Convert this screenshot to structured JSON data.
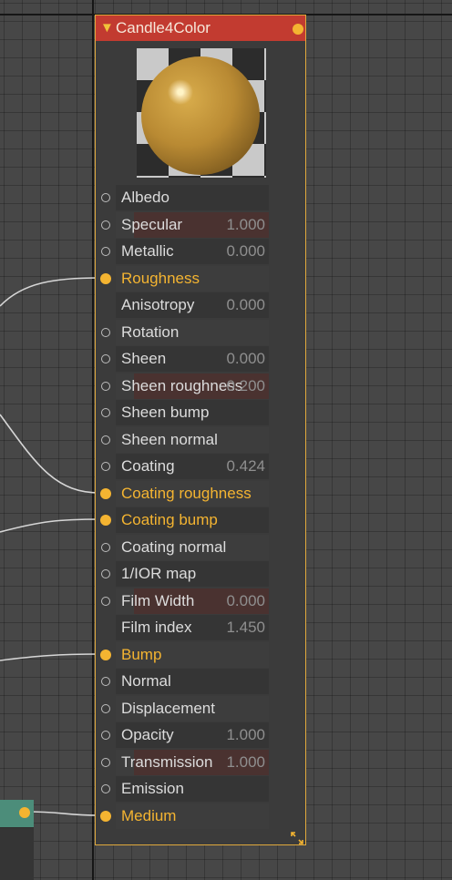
{
  "node": {
    "title": "Candle4Color",
    "collapse_glyph": "▼",
    "header_color": "#c23b30",
    "border_color": "#e0a93c",
    "connected_color": "#f4b431",
    "pins": [
      {
        "label": "Albedo",
        "value": "",
        "connected": false,
        "pin": true
      },
      {
        "label": "Specular",
        "value": "1.000",
        "connected": false,
        "pin": true,
        "fill": 1.0
      },
      {
        "label": "Metallic",
        "value": "0.000",
        "connected": false,
        "pin": true
      },
      {
        "label": "Roughness",
        "value": "",
        "connected": true,
        "pin": true
      },
      {
        "label": "Anisotropy",
        "value": "0.000",
        "connected": false,
        "pin": false
      },
      {
        "label": "Rotation",
        "value": "",
        "connected": false,
        "pin": true
      },
      {
        "label": "Sheen",
        "value": "0.000",
        "connected": false,
        "pin": true
      },
      {
        "label": "Sheen roughness",
        "value": "0.200",
        "connected": false,
        "pin": true,
        "fill": 1.0
      },
      {
        "label": "Sheen bump",
        "value": "",
        "connected": false,
        "pin": true
      },
      {
        "label": "Sheen normal",
        "value": "",
        "connected": false,
        "pin": true
      },
      {
        "label": "Coating",
        "value": "0.424",
        "connected": false,
        "pin": true
      },
      {
        "label": "Coating roughness",
        "value": "",
        "connected": true,
        "pin": true
      },
      {
        "label": "Coating bump",
        "value": "",
        "connected": true,
        "pin": true
      },
      {
        "label": "Coating normal",
        "value": "",
        "connected": false,
        "pin": true
      },
      {
        "label": "1/IOR map",
        "value": "",
        "connected": false,
        "pin": true
      },
      {
        "label": "Film Width",
        "value": "0.000",
        "connected": false,
        "pin": true,
        "fill": 1.0
      },
      {
        "label": "Film index",
        "value": "1.450",
        "connected": false,
        "pin": false
      },
      {
        "label": "Bump",
        "value": "",
        "connected": true,
        "pin": true
      },
      {
        "label": "Normal",
        "value": "",
        "connected": false,
        "pin": true
      },
      {
        "label": "Displacement",
        "value": "",
        "connected": false,
        "pin": true
      },
      {
        "label": "Opacity",
        "value": "1.000",
        "connected": false,
        "pin": true
      },
      {
        "label": "Transmission",
        "value": "1.000",
        "connected": false,
        "pin": true,
        "fill": 1.0
      },
      {
        "label": "Emission",
        "value": "",
        "connected": false,
        "pin": true
      },
      {
        "label": "Medium",
        "value": "",
        "connected": true,
        "pin": true
      }
    ]
  },
  "icons": {
    "collapse": "triangle-down-icon",
    "output": "output-pin-icon",
    "resize": "resize-corner-icon"
  }
}
